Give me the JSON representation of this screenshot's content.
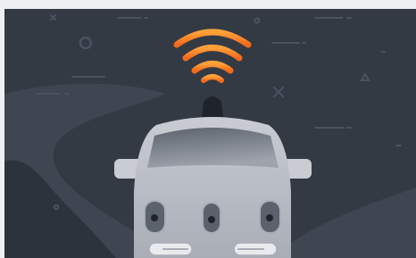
{
  "illustration": {
    "subject": "self-driving-car",
    "icons": [
      "wifi-signal-icon",
      "lidar-sensor-icon",
      "self-driving-car-icon"
    ],
    "colors": {
      "background": "#343a44",
      "road": "#3f4652",
      "road_dark": "#2d333c",
      "car_body": "#c9ccd3",
      "car_body_shade": "#a9adb6",
      "windshield_top": "#5b626d",
      "windshield_bottom": "#9ea3ac",
      "sensor": "#1f232a",
      "wifi_light": "#ffa23a",
      "wifi_dark": "#f26a1b",
      "decoration": "#4b5260"
    }
  }
}
